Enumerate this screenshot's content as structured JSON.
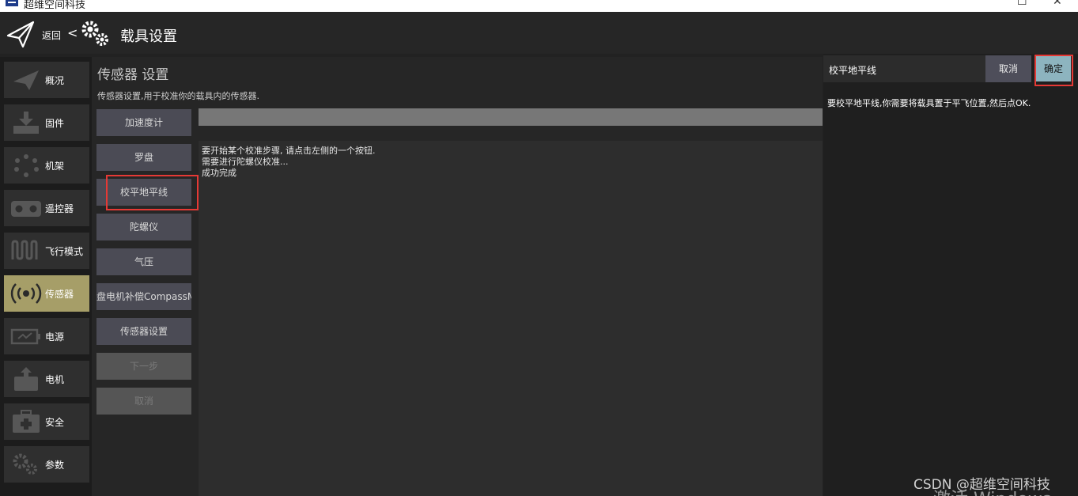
{
  "window": {
    "title": "超维空间科技",
    "minimize_symbol": "☐",
    "close_symbol": "✕"
  },
  "header": {
    "back_label": "返回",
    "back_chevron": "<",
    "title": "载具设置",
    "icons": [
      "paper-plane-icon",
      "gears-icon"
    ]
  },
  "sidebar": {
    "items": [
      {
        "label": "概况",
        "icon": "plane-icon"
      },
      {
        "label": "固件",
        "icon": "download-icon"
      },
      {
        "label": "机架",
        "icon": "frame-dots-icon"
      },
      {
        "label": "遥控器",
        "icon": "remote-control-icon"
      },
      {
        "label": "飞行模式",
        "icon": "wave-icon"
      },
      {
        "label": "传感器",
        "icon": "sensor-icon",
        "active": true
      },
      {
        "label": "电源",
        "icon": "battery-icon"
      },
      {
        "label": "电机",
        "icon": "motor-icon"
      },
      {
        "label": "安全",
        "icon": "medkit-icon"
      },
      {
        "label": "参数",
        "icon": "gears-icon"
      }
    ]
  },
  "sensor": {
    "title": "传感器 设置",
    "description": "传感器设置,用于校准你的载具内的传感器.",
    "buttons": [
      {
        "label": "加速度计",
        "enabled": true
      },
      {
        "label": "罗盘",
        "enabled": true
      },
      {
        "label": "校平地平线",
        "enabled": true,
        "highlighted": true
      },
      {
        "label": "陀螺仪",
        "enabled": true
      },
      {
        "label": "气压",
        "enabled": true
      },
      {
        "label": "盘电机补偿CompassM",
        "enabled": true
      },
      {
        "label": "传感器设置",
        "enabled": true
      },
      {
        "label": "下一步",
        "enabled": false
      },
      {
        "label": "取消",
        "enabled": false
      }
    ],
    "log_lines": [
      "要开始某个校准步骤, 请点击左侧的一个按钮.",
      "需要进行陀螺仪校准...",
      "成功完成"
    ]
  },
  "dialog": {
    "title": "校平地平线",
    "cancel_label": "取消",
    "confirm_label": "确定",
    "message": "要校平地平线,你需要将载具置于平飞位置,然后点OK."
  },
  "overlay": {
    "watermark": "CSDN @超维空间科技",
    "activate_windows": "激活 Windows"
  },
  "colors": {
    "background": "#222222",
    "sidebar_active": "#a69e68",
    "button": "#4b4b55",
    "confirm_button": "#8db4bf",
    "highlight": "#e53935"
  }
}
